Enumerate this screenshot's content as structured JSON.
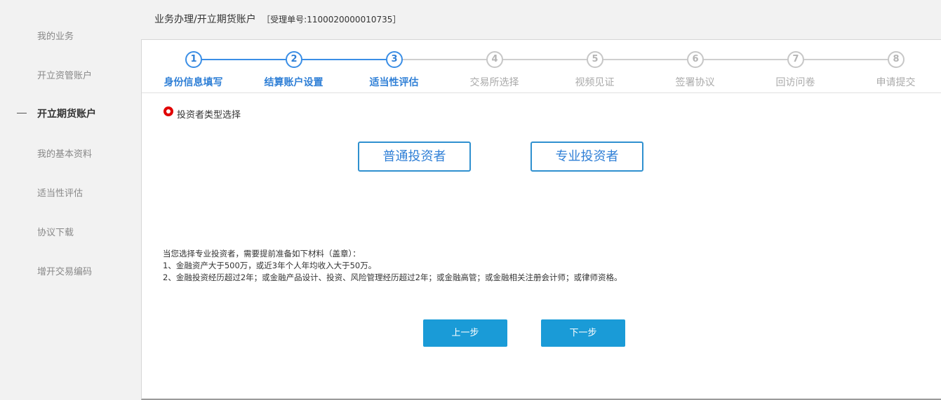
{
  "sidebar": {
    "items": [
      {
        "label": "我的业务"
      },
      {
        "label": "开立资管账户"
      },
      {
        "label": "开立期货账户"
      },
      {
        "label": "我的基本资料"
      },
      {
        "label": "适当性评估"
      },
      {
        "label": "协议下载"
      },
      {
        "label": "增开交易编码"
      }
    ]
  },
  "breadcrumb": {
    "path": "业务办理/开立期货账户",
    "order": "［受理单号:1100020000010735］"
  },
  "steps": [
    {
      "num": "1",
      "label": "身份信息填写"
    },
    {
      "num": "2",
      "label": "结算账户设置"
    },
    {
      "num": "3",
      "label": "适当性评估"
    },
    {
      "num": "4",
      "label": "交易所选择"
    },
    {
      "num": "5",
      "label": "视频见证"
    },
    {
      "num": "6",
      "label": "签署协议"
    },
    {
      "num": "7",
      "label": "回访问卷"
    },
    {
      "num": "8",
      "label": "申请提交"
    }
  ],
  "main": {
    "section_title": "投资者类型选择",
    "investor_types": [
      "普通投资者",
      "专业投资者"
    ],
    "notes": [
      "当您选择专业投资者，需要提前准备如下材料（盖章）：",
      "1、金融资产大于500万，或近3年个人年均收入大于50万。",
      "2、金融投资经历超过2年；或金融产品设计、投资、风险管理经历超过2年；或金融高管；或金融相关注册会计师；或律师资格。"
    ],
    "prev_label": "上一步",
    "next_label": "下一步"
  },
  "colors": {
    "accent": "#2f7fd6",
    "button": "#1a9bd7",
    "radio": "#e10000"
  }
}
